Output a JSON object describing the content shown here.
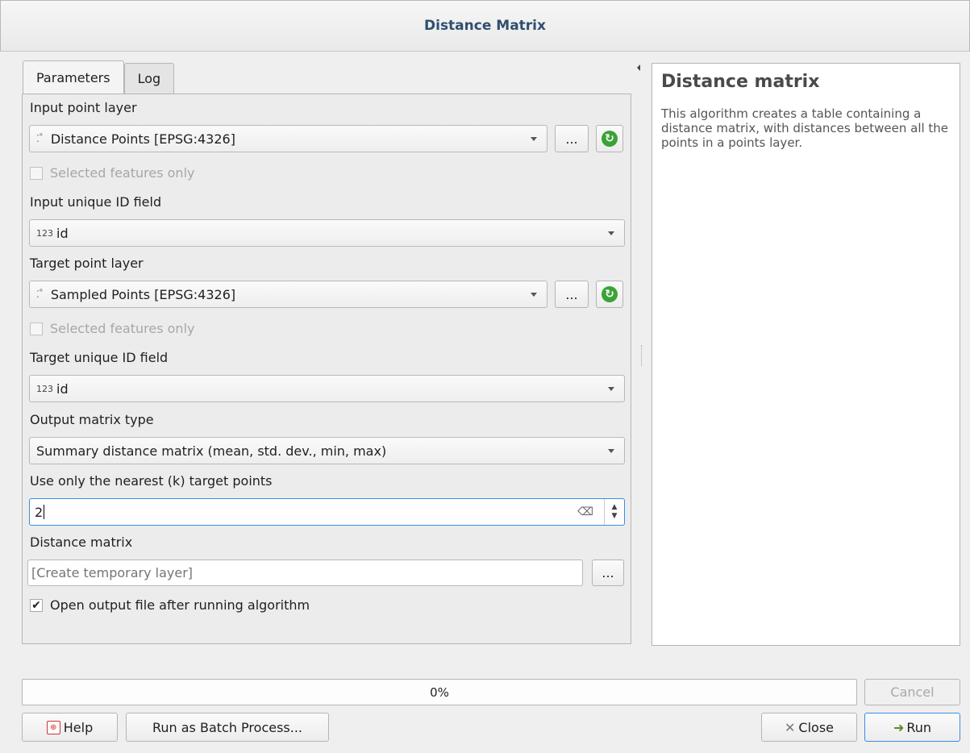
{
  "window": {
    "title": "Distance Matrix"
  },
  "tabs": [
    {
      "label": "Parameters"
    },
    {
      "label": "Log"
    }
  ],
  "form": {
    "input_layer": {
      "label": "Input point layer",
      "value": "Distance Points [EPSG:4326]",
      "selected_only": "Selected features only",
      "browse": "..."
    },
    "input_id": {
      "label": "Input unique ID field",
      "value": "id"
    },
    "target_layer": {
      "label": "Target point layer",
      "value": "Sampled Points [EPSG:4326]",
      "selected_only": "Selected features only",
      "browse": "..."
    },
    "target_id": {
      "label": "Target unique ID field",
      "value": "id"
    },
    "matrix_type": {
      "label": "Output matrix type",
      "value": "Summary distance matrix (mean, std. dev., min, max)"
    },
    "nearest_k": {
      "label": "Use only the nearest (k) target points",
      "value": "2"
    },
    "output": {
      "label": "Distance matrix",
      "placeholder": "[Create temporary layer]",
      "browse": "..."
    },
    "open_output": {
      "label": "Open output file after running algorithm",
      "checked": true
    },
    "field_type_icon": "123"
  },
  "help_panel": {
    "title": "Distance matrix",
    "body": "This algorithm creates a table containing a distance matrix, with distances between all the points in a points layer."
  },
  "progress": {
    "text": "0%",
    "value": 0
  },
  "buttons": {
    "cancel": "Cancel",
    "help": "Help",
    "batch": "Run as Batch Process...",
    "close": "Close",
    "run": "Run"
  },
  "colors": {
    "accent": "#3a8ee6",
    "title": "#2f4f6f",
    "refresh": "#3aa335"
  }
}
